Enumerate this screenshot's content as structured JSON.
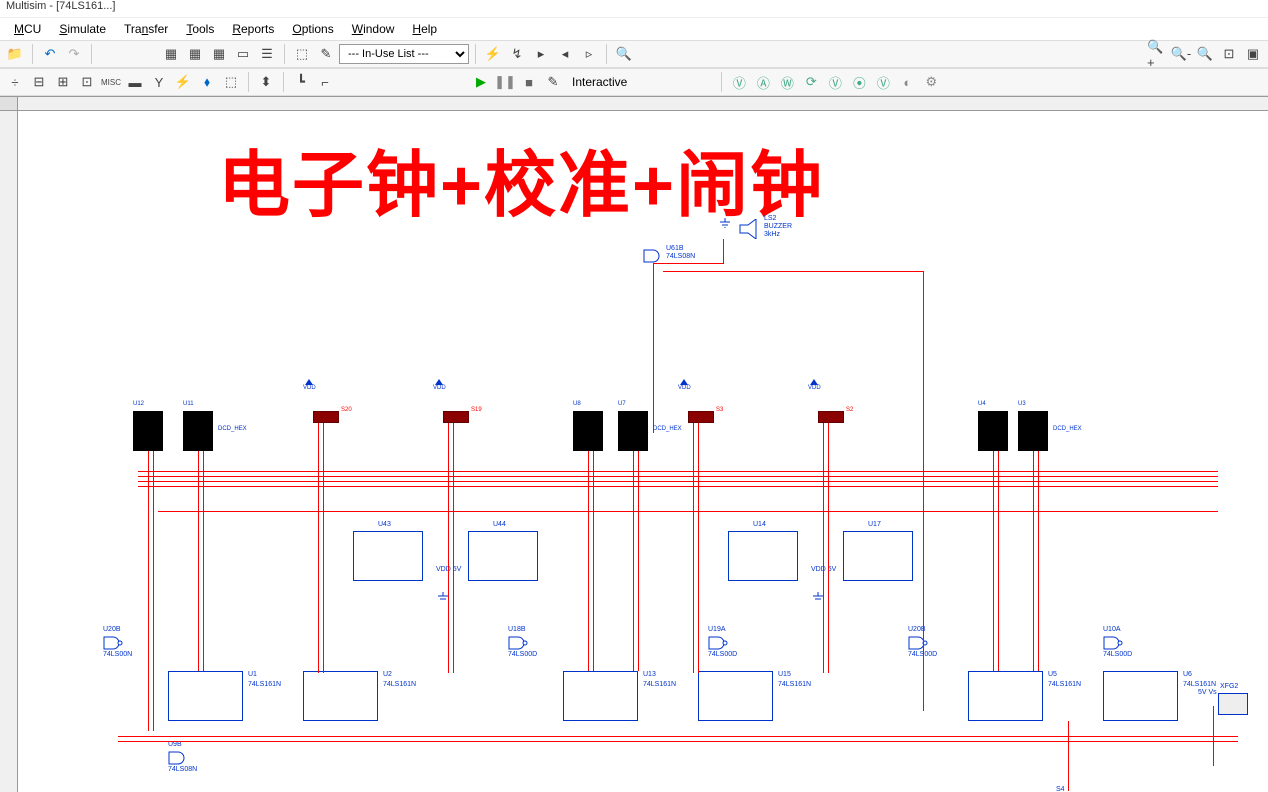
{
  "app": {
    "title_fragment": "Multisim - [74LS161...]"
  },
  "menu": {
    "mcu": "MCU",
    "simulate": "Simulate",
    "transfer": "Transfer",
    "tools": "Tools",
    "reports": "Reports",
    "options": "Options",
    "window": "Window",
    "help": "Help"
  },
  "toolbar1": {
    "inuse_list": "--- In-Use List ---"
  },
  "toolbar2": {
    "interactive": "Interactive"
  },
  "schematic": {
    "big_title": "电子钟+校准+闹钟",
    "buzzer": {
      "ref": "LS2",
      "name": "BUZZER",
      "freq": "3kHz"
    },
    "gate_top": {
      "ref": "U61B",
      "name": "74LS08N"
    },
    "displays": [
      {
        "ref": "U12",
        "type": "DCD_HEX"
      },
      {
        "ref": "U11",
        "type": "DCD_HEX"
      },
      {
        "ref": "U8",
        "type": ""
      },
      {
        "ref": "U7",
        "type": "DCD_HEX"
      },
      {
        "ref": "U4",
        "type": ""
      },
      {
        "ref": "U3",
        "type": "DCD_HEX"
      }
    ],
    "dips": [
      {
        "ref": "S20"
      },
      {
        "ref": "S19"
      },
      {
        "ref": "S3"
      },
      {
        "ref": "S2"
      }
    ],
    "vdd_label": "VDD",
    "vdd_5v": "5V",
    "chips_mid": [
      {
        "ref": "U43"
      },
      {
        "ref": "U44"
      },
      {
        "ref": "U14"
      },
      {
        "ref": "U17"
      }
    ],
    "gates_low": [
      {
        "ref": "U20B",
        "name": "74LS00N"
      },
      {
        "ref": "U18B",
        "name": "74LS00D"
      },
      {
        "ref": "U19A",
        "name": "74LS00D"
      },
      {
        "ref": "U20B",
        "name": "74LS00D"
      },
      {
        "ref": "U10A",
        "name": "74LS00D"
      }
    ],
    "counters": [
      {
        "ref": "U1",
        "name": "74LS161N"
      },
      {
        "ref": "U2",
        "name": "74LS161N"
      },
      {
        "ref": "U13",
        "name": "74LS161N"
      },
      {
        "ref": "U15",
        "name": "74LS161N"
      },
      {
        "ref": "U5",
        "name": "74LS161N"
      },
      {
        "ref": "U6",
        "name": "74LS161N"
      }
    ],
    "gate_bottom": {
      "ref": "U9B",
      "name": "74LS08N"
    },
    "probe": {
      "ref": "XFG2"
    },
    "sw_bottom": "S4",
    "vs_5v": "5V Vs"
  }
}
